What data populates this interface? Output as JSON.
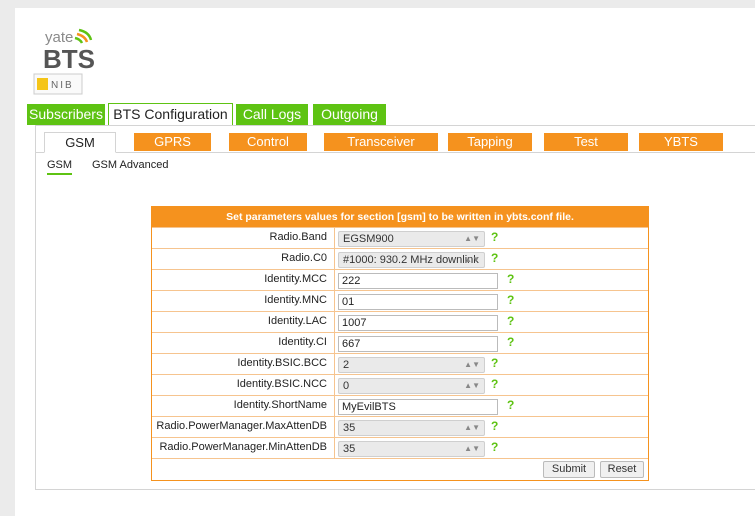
{
  "logo": {
    "top_text": "yate",
    "main_text": "BTS",
    "badge_text": "NIB"
  },
  "top_tabs": [
    {
      "label": "Subscribers",
      "active": false
    },
    {
      "label": "BTS Configuration",
      "active": true
    },
    {
      "label": "Call Logs",
      "active": false
    },
    {
      "label": "Outgoing",
      "active": false
    }
  ],
  "section_tabs": [
    {
      "label": "GSM",
      "active": true
    },
    {
      "label": "GPRS",
      "active": false
    },
    {
      "label": "Control",
      "active": false
    },
    {
      "label": "Transceiver",
      "active": false
    },
    {
      "label": "Tapping",
      "active": false
    },
    {
      "label": "Test",
      "active": false
    },
    {
      "label": "YBTS",
      "active": false
    }
  ],
  "sub_tabs": [
    {
      "label": "GSM",
      "active": true
    },
    {
      "label": "GSM Advanced",
      "active": false
    }
  ],
  "form": {
    "header": "Set parameters values for section [gsm] to be written in ybts.conf file.",
    "help_label": "?",
    "fields": [
      {
        "label": "Radio.Band",
        "type": "select",
        "value": "EGSM900"
      },
      {
        "label": "Radio.C0",
        "type": "select",
        "value": "#1000: 930.2 MHz downlink"
      },
      {
        "label": "Identity.MCC",
        "type": "text",
        "value": "222"
      },
      {
        "label": "Identity.MNC",
        "type": "text",
        "value": "01"
      },
      {
        "label": "Identity.LAC",
        "type": "text",
        "value": "1007"
      },
      {
        "label": "Identity.CI",
        "type": "text",
        "value": "667"
      },
      {
        "label": "Identity.BSIC.BCC",
        "type": "select",
        "value": "2"
      },
      {
        "label": "Identity.BSIC.NCC",
        "type": "select",
        "value": "0"
      },
      {
        "label": "Identity.ShortName",
        "type": "text",
        "value": "MyEvilBTS"
      },
      {
        "label": "Radio.PowerManager.MaxAttenDB",
        "type": "select",
        "value": "35"
      },
      {
        "label": "Radio.PowerManager.MinAttenDB",
        "type": "select",
        "value": "35"
      }
    ],
    "submit_label": "Submit",
    "reset_label": "Reset"
  },
  "colors": {
    "green": "#5ec313",
    "orange": "#f5921e"
  }
}
